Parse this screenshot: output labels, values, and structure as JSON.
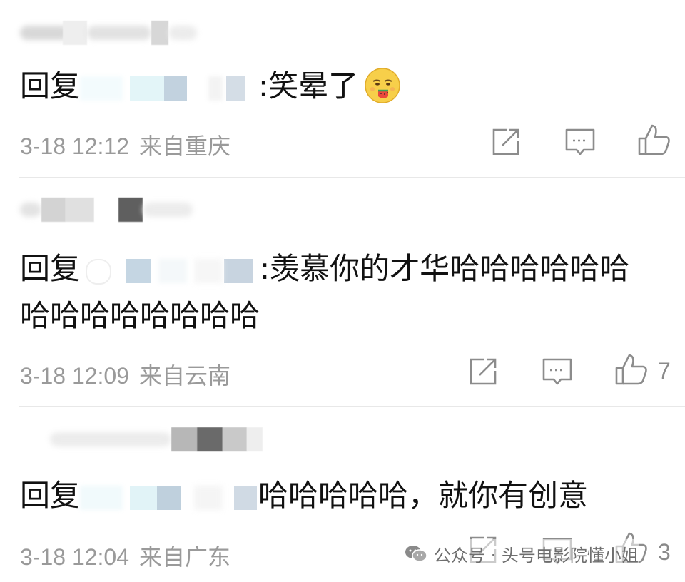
{
  "comments": [
    {
      "reply_prefix": "回复",
      "reply_text": ":笑晕了",
      "emoji": "grinning-face-with-watermelon-emoji",
      "time": "3-18 12:12",
      "location": "来自重庆",
      "like_count": ""
    },
    {
      "reply_prefix": "回复",
      "reply_text": ":羡慕你的才华哈哈哈哈哈哈",
      "reply_text_line2": "哈哈哈哈哈哈哈哈",
      "time": "3-18 12:09",
      "location": "来自云南",
      "like_count": "7"
    },
    {
      "reply_prefix": "回复",
      "reply_text": "哈哈哈哈哈，就你有创意",
      "time": "3-18 12:04",
      "location": "来自广东",
      "like_count": "3"
    }
  ],
  "watermark": {
    "text": "公众号 · 头号电影院懂小姐"
  },
  "icons": {
    "share": "share-icon",
    "comment": "comment-icon",
    "like": "thumbs-up-icon"
  },
  "colors": {
    "meta_text": "#9a9a9a",
    "divider": "#e8e8e8",
    "icon_stroke": "#8c8c8c"
  }
}
